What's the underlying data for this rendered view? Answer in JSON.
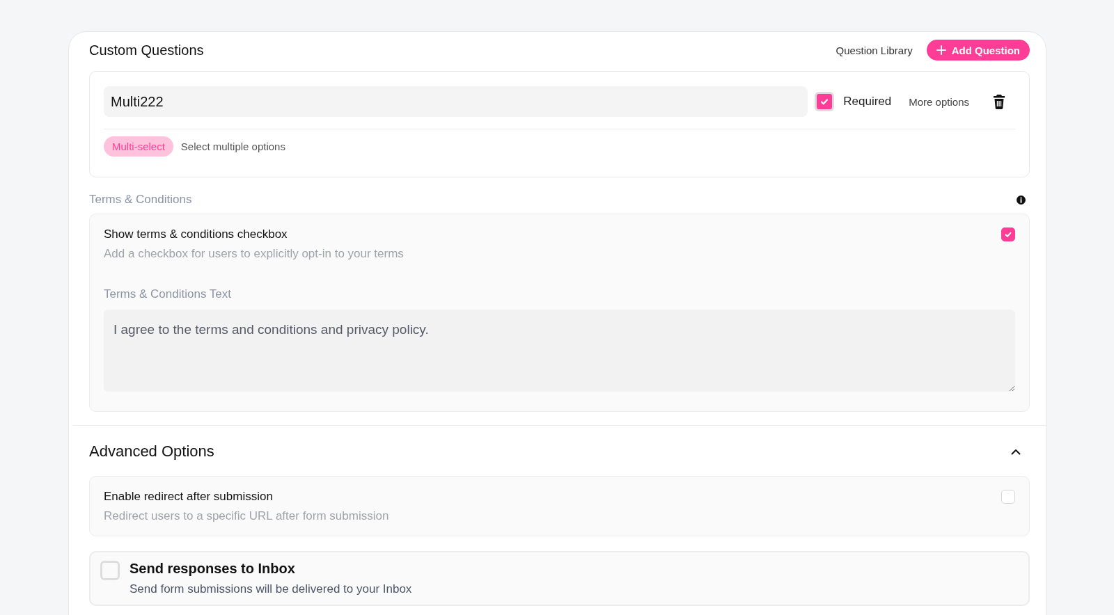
{
  "header": {
    "title": "Custom Questions",
    "library_link": "Question Library",
    "add_button": "Add Question"
  },
  "question": {
    "name": "Multi222",
    "required": true,
    "required_label": "Required",
    "more_options": "More options",
    "type_tag": "Multi-select",
    "type_description": "Select multiple options"
  },
  "terms": {
    "section_label": "Terms & Conditions",
    "toggle": {
      "title": "Show terms & conditions checkbox",
      "description": "Add a checkbox for users to explicitly opt-in to your terms",
      "checked": true
    },
    "text_label": "Terms & Conditions Text",
    "text_value": "I agree to the terms and conditions and privacy policy."
  },
  "advanced": {
    "title": "Advanced Options",
    "expanded": true,
    "options": [
      {
        "kind": "right-checkbox",
        "title": "Enable redirect after submission",
        "description": "Redirect users to a specific URL after form submission",
        "checked": false
      },
      {
        "kind": "left-checkbox",
        "title": "Send responses to Inbox",
        "description": "Send form submissions will be delivered to your Inbox",
        "checked": false
      }
    ]
  }
}
